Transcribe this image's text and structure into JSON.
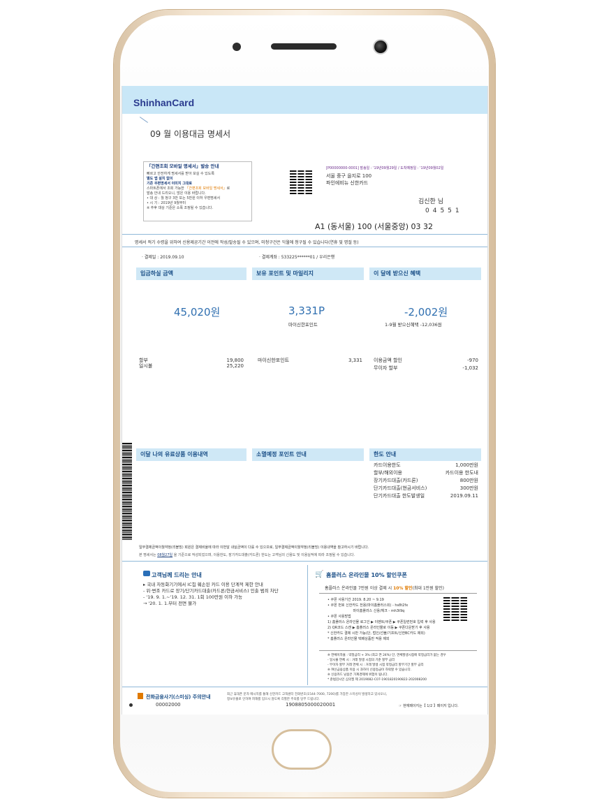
{
  "header": {
    "brand": "ShinhanCard",
    "title": "09 월 이용대금 명세서"
  },
  "notice": {
    "title": "「간편조회 모바일 명세서」발송 안내",
    "l1": "빠르고 안전하게 명세서를 받아 보실 수 있도록",
    "l2": "별도 앱 설치 없이",
    "l3": "기존 우편명세서 이미지 그대로",
    "l4a": "스마트폰에서 조회 가능한 ",
    "l4b": "「간편조회 모바일 명세서」",
    "l4c": "로",
    "l5": "발송 안내 드리오니, 많은 이용 바랍니다.",
    "l6": "• 대 상 : 월 청구 3만 또는 5만원 이하 우편명세서",
    "l7": "• 시 기 : 2019년 9월부터",
    "l8": "※ 추후 대상 기준은 소폭 조정될 수 있습니다."
  },
  "address": {
    "meta": "[P00000000-0001] 발송일 : '19년09월29일 / 도착예정일 : '19년09월02일",
    "line1": "서울 중구 을지로 100",
    "line2": "파인에비뉴 신한카드",
    "name": "김신한 님",
    "zip": "04551",
    "route": "A1 (동서울) 100 (서울중앙) 03 32"
  },
  "disclaimer": "명세서 적기 수령을 위하여 신용제공기간 이전에 작성/발송될 수 있으며, 미청구건은 익월에 청구될 수 있습니다(연휴 및 명절 등)",
  "payment": {
    "date": "· 결제일 : 2019.09.10",
    "account": "· 결제계좌 : 533225******01 / 우리은행"
  },
  "sections": {
    "amount": {
      "title": "입금하실 금액",
      "value": "45,020원",
      "rows": [
        {
          "label": "할부",
          "value": "19,800"
        },
        {
          "label": "일시불",
          "value": "25,220"
        }
      ]
    },
    "points": {
      "title": "보유 포인트 및 마일리지",
      "value": "3,331P",
      "sub": "마이신한포인트",
      "rows": [
        {
          "label": "마이신한포인트",
          "value": "3,331"
        }
      ]
    },
    "benefit": {
      "title": "이 달에 받으신 혜택",
      "value": "-2,002원",
      "sub": "1-9월 받으신혜택  -12,036원",
      "rows": [
        {
          "label": "이용금액 할인",
          "value": "-970"
        },
        {
          "label": "무이자 할부",
          "value": "-1,032"
        }
      ]
    },
    "products": {
      "title": "이달 나의 유료상품 이용내역"
    },
    "expire": {
      "title": "소멸예정 포인트 안내"
    },
    "limit": {
      "title": "한도 안내",
      "rows": [
        {
          "label": "카드이용한도",
          "value": "1,000만원"
        },
        {
          "label": "할부/해외이용",
          "value": "카드이용 한도내"
        },
        {
          "label": "장기카드대출(카드론)",
          "value": "800만원"
        },
        {
          "label": "단기카드대출(현금서비스)",
          "value": "300만원"
        },
        {
          "label": "단기카드대출 한도발생일",
          "value": "2019.09.11"
        }
      ]
    }
  },
  "notes": {
    "n1": "일부결제금액이월약정(리볼빙) 회원은 결제비율에 따라 이번달 내실금액이 다를 수 있으므로, 일부결제금액이월약정(리볼빙) 이용내역을 참고하시기 바랍니다.",
    "n2a": "본 명세서는 ",
    "n2b": "08월27일",
    "n2c": " 을 기준으로 작성되었으며, 이용한도, 장기카드대출(카드론) 한도는 고객님의 신용도 및 이용실적에 따라 조정될 수 있습니다."
  },
  "guide": {
    "title": "고객님께 드리는 안내",
    "lines": [
      "▸ 국내 자동화기기에서 IC칩 훼손된 카드 이용 단계적 제한 안내",
      "- 위·변조 카드로 장기/단기카드대출(카드론/현금서비스) 인출 범죄 차단",
      "- '19. 9. 1.~'19. 12. 31. 1회 100만원 이하 가능",
      "→ '20. 1. 1.부터 전면 불가"
    ]
  },
  "coupon": {
    "title": "홈플러스 온라인몰 10% 할인쿠폰",
    "subtitle_a": "홈플러스 온라인몰 7만원 이상 결제 시 ",
    "subtitle_b": "10% 할인",
    "subtitle_c": "(최대 1만원 할인)",
    "items": [
      "• 쿠폰 사용기간   2019. 8.20 ~ 9.19",
      "• 쿠폰 번호        신한카드 전용(마이홈플러스외) - hs8t2fx",
      "                       마이홈플러스 신용/체크 - mh3t9q",
      "• 쿠폰 사용방법",
      "  1) 홈플러스 온라인몰 로그인 ▶ 이벤트/쿠폰 ▶ 쿠폰일련번호 입력 후 사용",
      "  2) QR코드 스캔 ▶ 홈플러스 온라인몰로 이동 ▶ 쿠폰다운받기 후 사용",
      "* 신한카드 결제 시만 가능(단, 법인/선불/기프트/신한BC카드 제외)",
      "* 홈플러스 온라인몰 택배상품만 적용 제외"
    ],
    "fine": [
      "※ 연체이자율 : 약정금리 + 3% (최고 연 24%) 단, 연체발생시점에 약정금리가 없는 경우",
      "  - 일시불 연체 시 : 거래 발생 시점의 기준 할부 금리",
      "  - 무이자 할부 거래 연체 시 : 거래 발생 시점 약정금리 할부기간 할부 금리",
      "※ 여신금융상품 이용 시 과하이 신용등급이 하락할 수 있습니다.",
      "※ 신용카드 남용은 가계경제에 위험이 됩니다.",
      "* 준법감시인 심의필 제 2019082-C07-1901820190822-202008200"
    ]
  },
  "footer": {
    "title": "전화금융사기(스미싱) 주의안내",
    "code1": "00002000",
    "text1": "최근 휴대폰 문자 메시지를 통해 신한카드 고객센터 전화번호(1544-7000, 7200)를 가장한 스미싱이 발생하고 있사오니,",
    "text2": "정보유출로 인하여 피해를 입으시 않도록 각별한 주의를 당부 드립니다.",
    "code2": "1908805000020001",
    "page": "☞ 현재페이지는【 1/2 】페이지 입니다."
  }
}
